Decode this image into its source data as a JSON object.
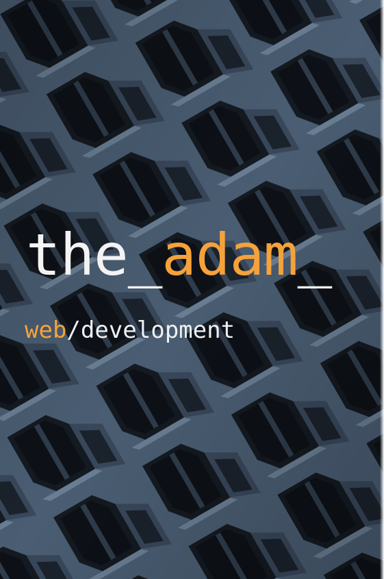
{
  "brand": {
    "part1": "the_",
    "part2": "adam",
    "part3": "_"
  },
  "tagline": {
    "part1": "web",
    "part2": "/development"
  },
  "colors": {
    "accent": "#f6a23b",
    "text": "#f3f3f3",
    "background_steel": "#4a5d72",
    "background_shadow": "#141a21"
  }
}
